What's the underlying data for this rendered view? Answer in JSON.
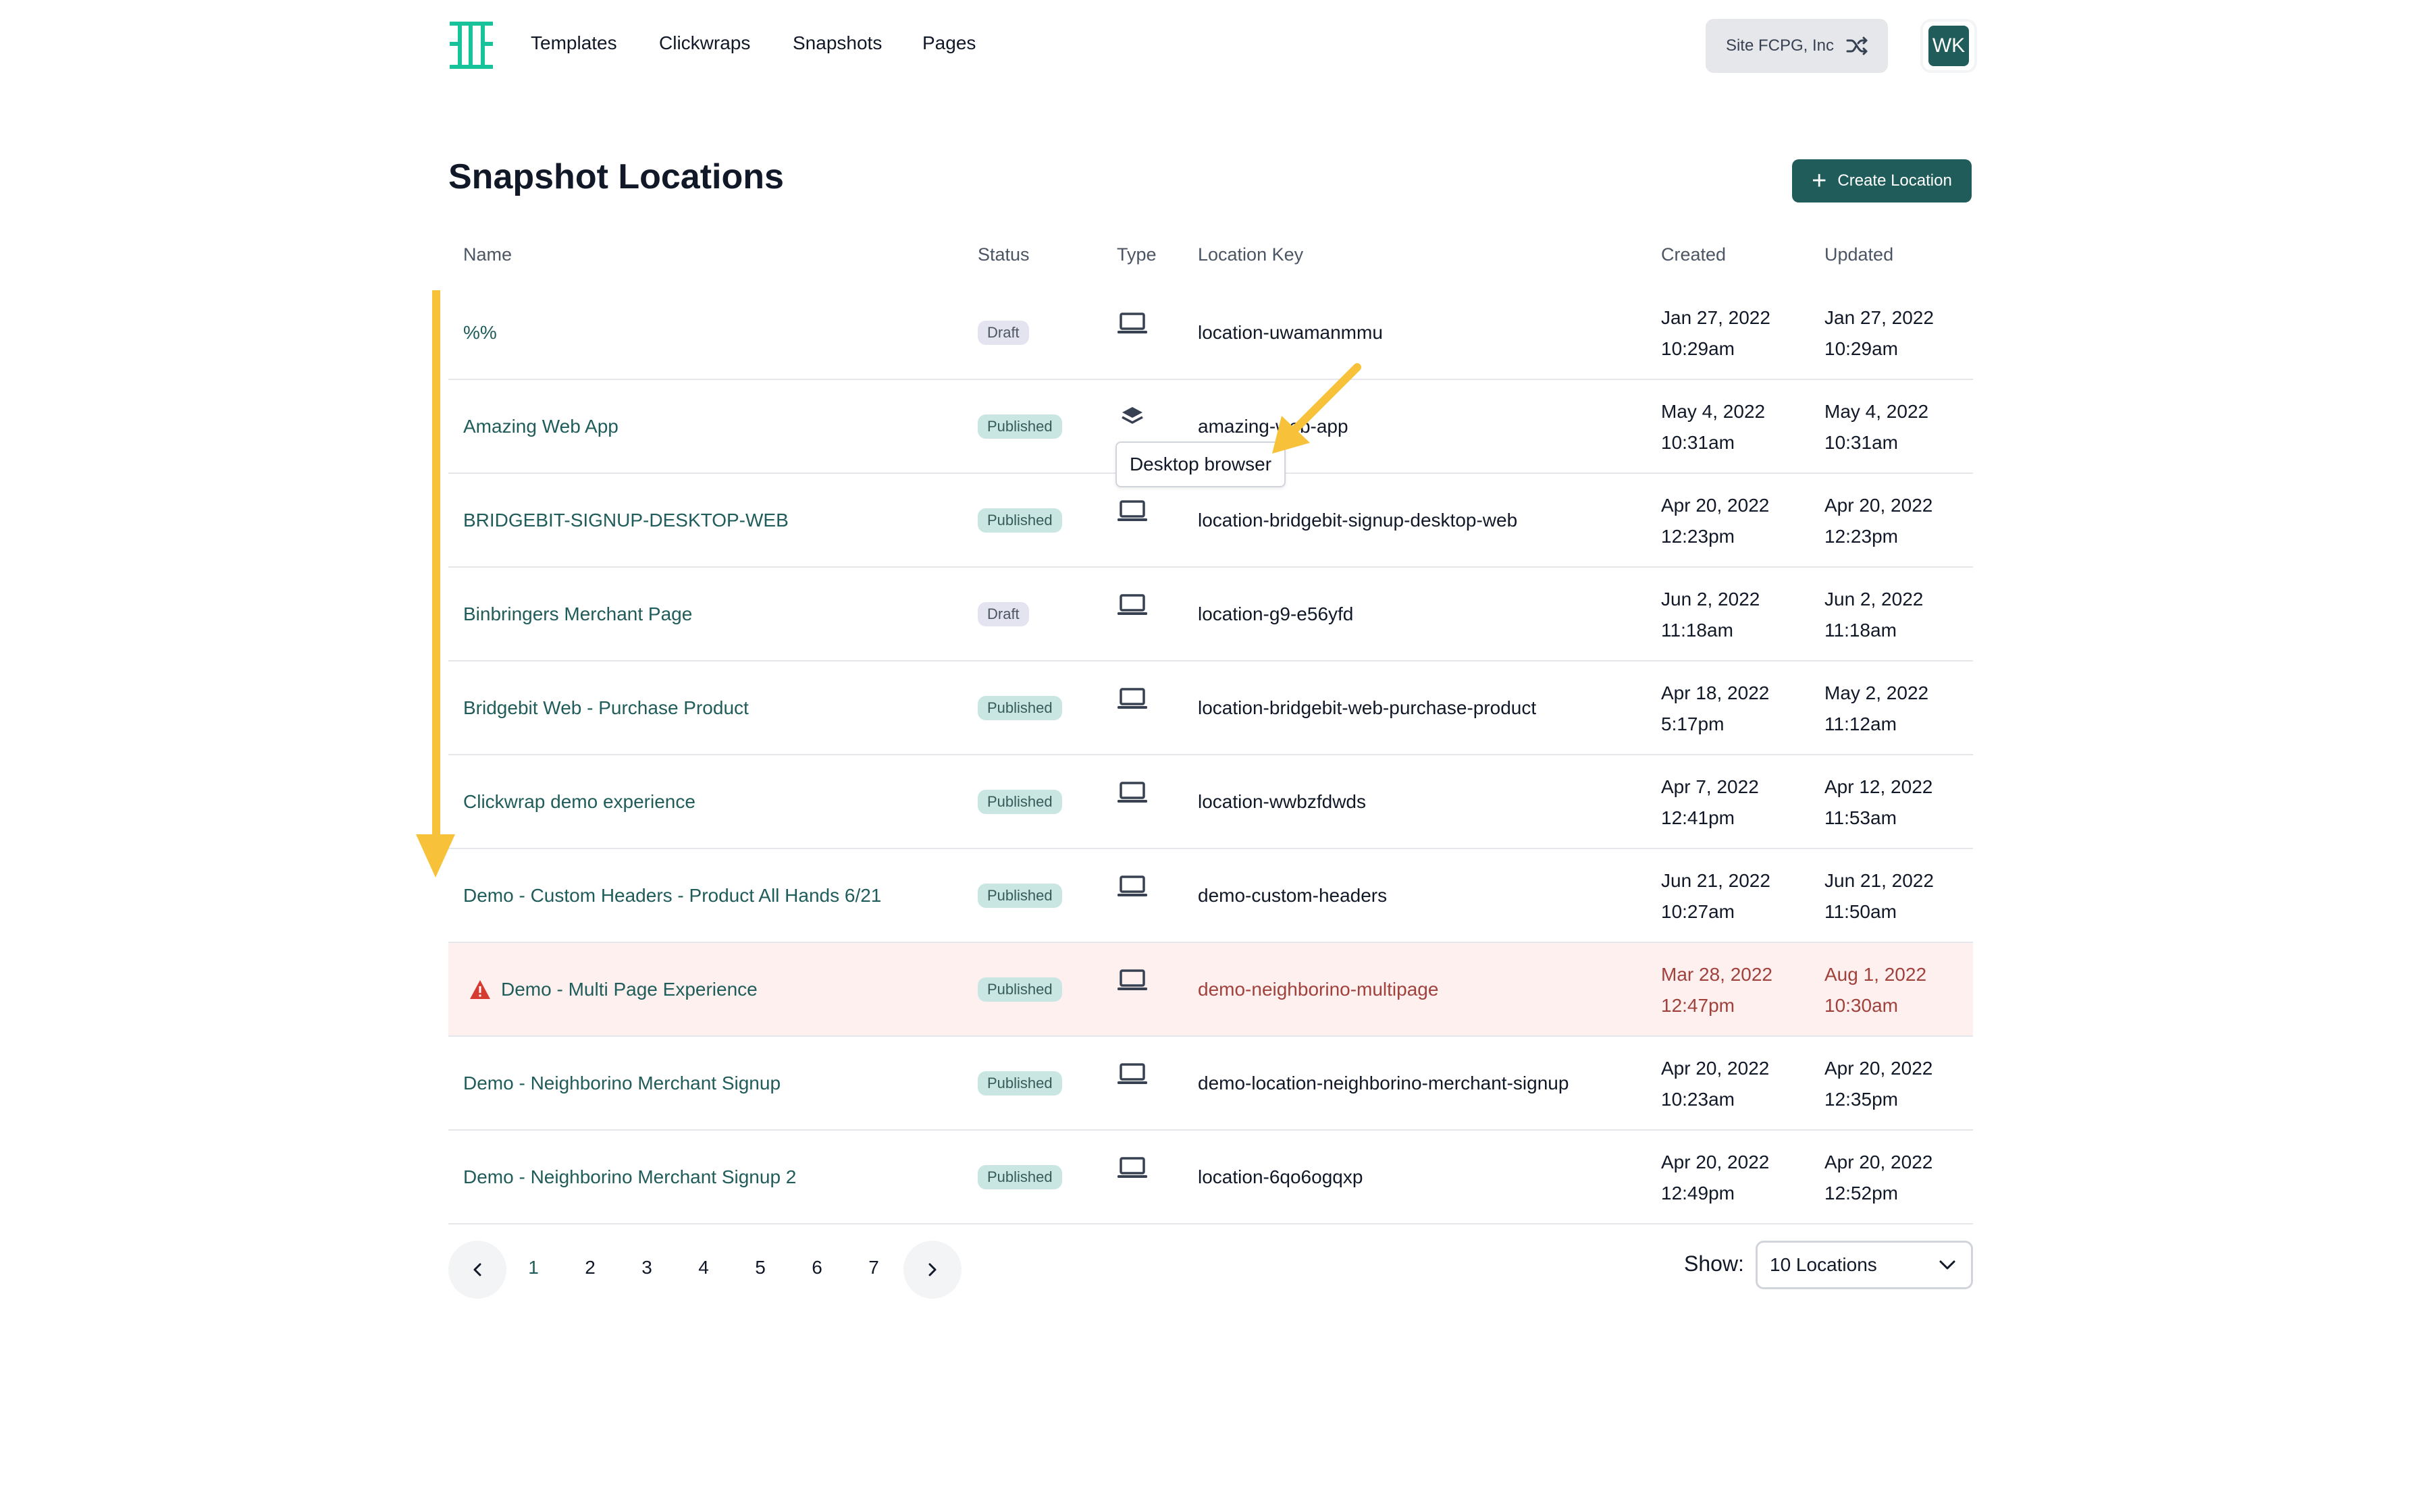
{
  "nav": {
    "links": [
      "Templates",
      "Clickwraps",
      "Snapshots",
      "Pages"
    ],
    "site_label": "Site FCPG, Inc",
    "avatar_initials": "WK"
  },
  "page": {
    "title": "Snapshot Locations",
    "create_label": "Create Location"
  },
  "table": {
    "headers": {
      "name": "Name",
      "status": "Status",
      "type": "Type",
      "key": "Location Key",
      "created": "Created",
      "updated": "Updated"
    },
    "rows": [
      {
        "name": "%%",
        "status": "Draft",
        "type": "desktop",
        "key": "location-uwamanmmu",
        "created_date": "Jan 27, 2022",
        "created_time": "10:29am",
        "updated_date": "Jan 27, 2022",
        "updated_time": "10:29am"
      },
      {
        "name": "Amazing Web App",
        "status": "Published",
        "type": "layers",
        "key": "amazing-web-app",
        "created_date": "May 4, 2022",
        "created_time": "10:31am",
        "updated_date": "May 4, 2022",
        "updated_time": "10:31am"
      },
      {
        "name": "BRIDGEBIT-SIGNUP-DESKTOP-WEB",
        "status": "Published",
        "type": "desktop",
        "key": "location-bridgebit-signup-desktop-web",
        "created_date": "Apr 20, 2022",
        "created_time": "12:23pm",
        "updated_date": "Apr 20, 2022",
        "updated_time": "12:23pm"
      },
      {
        "name": "Binbringers Merchant Page",
        "status": "Draft",
        "type": "desktop",
        "key": "location-g9-e56yfd",
        "created_date": "Jun 2, 2022",
        "created_time": "11:18am",
        "updated_date": "Jun 2, 2022",
        "updated_time": "11:18am"
      },
      {
        "name": "Bridgebit Web - Purchase Product",
        "status": "Published",
        "type": "desktop",
        "key": "location-bridgebit-web-purchase-product",
        "created_date": "Apr 18, 2022",
        "created_time": "5:17pm",
        "updated_date": "May 2, 2022",
        "updated_time": "11:12am"
      },
      {
        "name": "Clickwrap demo experience",
        "status": "Published",
        "type": "desktop",
        "key": "location-wwbzfdwds",
        "created_date": "Apr 7, 2022",
        "created_time": "12:41pm",
        "updated_date": "Apr 12, 2022",
        "updated_time": "11:53am"
      },
      {
        "name": "Demo - Custom Headers - Product All Hands 6/21",
        "status": "Published",
        "type": "desktop",
        "key": "demo-custom-headers",
        "created_date": "Jun 21, 2022",
        "created_time": "10:27am",
        "updated_date": "Jun 21, 2022",
        "updated_time": "11:50am"
      },
      {
        "name": "Demo - Multi Page Experience",
        "status": "Published",
        "type": "desktop",
        "key": "demo-neighborino-multipage",
        "created_date": "Mar 28, 2022",
        "created_time": "12:47pm",
        "updated_date": "Aug 1, 2022",
        "updated_time": "10:30am",
        "error": true
      },
      {
        "name": "Demo - Neighborino Merchant Signup",
        "status": "Published",
        "type": "desktop",
        "key": "demo-location-neighborino-merchant-signup",
        "created_date": "Apr 20, 2022",
        "created_time": "10:23am",
        "updated_date": "Apr 20, 2022",
        "updated_time": "12:35pm"
      },
      {
        "name": "Demo - Neighborino Merchant Signup 2",
        "status": "Published",
        "type": "desktop",
        "key": "location-6qo6ogqxp",
        "created_date": "Apr 20, 2022",
        "created_time": "12:49pm",
        "updated_date": "Apr 20, 2022",
        "updated_time": "12:52pm"
      }
    ]
  },
  "tooltip": {
    "text": "Desktop browser"
  },
  "pagination": {
    "pages": [
      "1",
      "2",
      "3",
      "4",
      "5",
      "6",
      "7"
    ],
    "current": "1"
  },
  "page_size": {
    "label": "Show:",
    "value": "10 Locations"
  },
  "colors": {
    "brand": "#1f5c5a",
    "logo": "#19c39a",
    "error_bg": "#fdf0ef",
    "error_text": "#a0413c",
    "annotation": "#f7c23a"
  }
}
